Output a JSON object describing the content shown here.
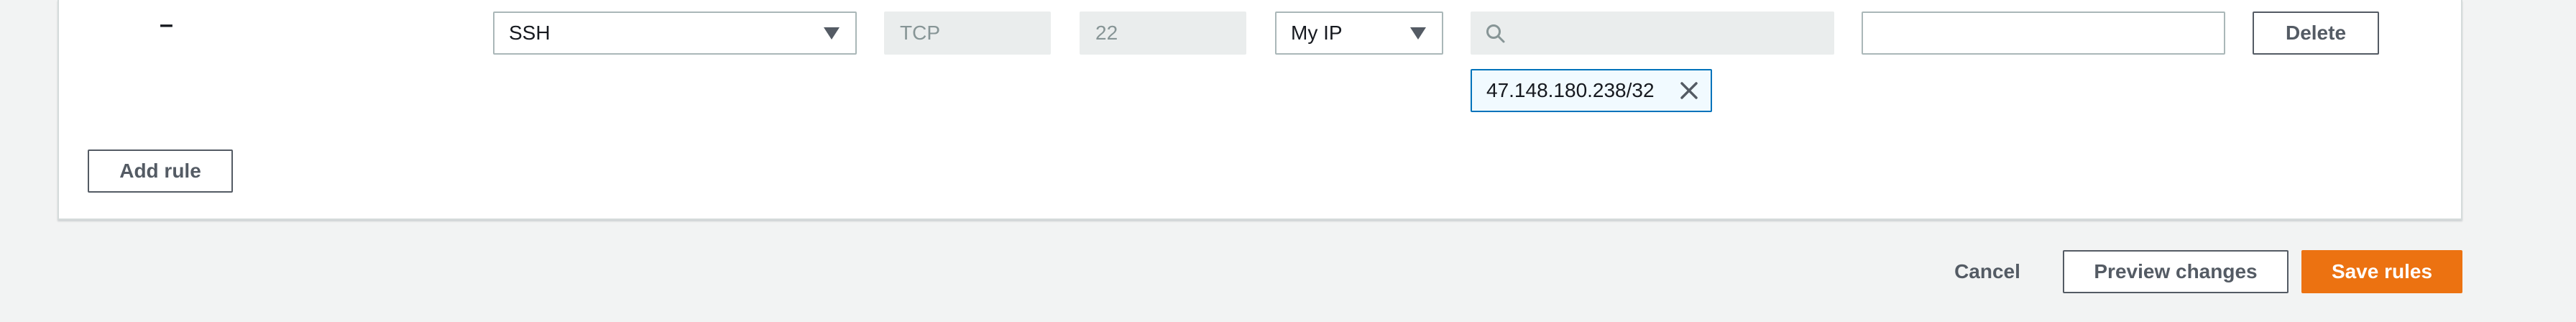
{
  "rule": {
    "remove_marker": "–",
    "type": {
      "value": "SSH",
      "icon": "caret-down-icon"
    },
    "protocol": {
      "value": "TCP"
    },
    "port_range": {
      "value": "22"
    },
    "source": {
      "value": "My IP",
      "icon": "caret-down-icon"
    },
    "cidr_search": {
      "value": "",
      "placeholder": "",
      "icon": "search-icon"
    },
    "cidr_tokens": [
      {
        "value": "47.148.180.238/32",
        "remove_icon": "close-icon"
      }
    ],
    "description": {
      "value": "",
      "placeholder": ""
    },
    "delete_label": "Delete"
  },
  "add_rule_label": "Add rule",
  "footer": {
    "cancel_label": "Cancel",
    "preview_label": "Preview changes",
    "save_label": "Save rules"
  },
  "colors": {
    "primary": "#ec7211",
    "token_border": "#0073bb",
    "token_bg": "#f1faff",
    "page_bg": "#f2f3f3"
  }
}
